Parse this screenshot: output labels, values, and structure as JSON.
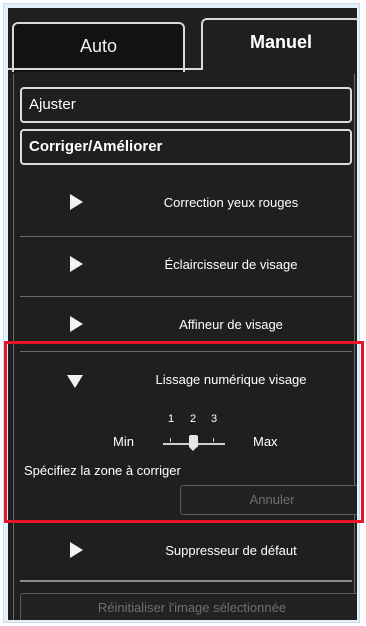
{
  "tabs": {
    "auto_label": "Auto",
    "manual_label": "Manuel"
  },
  "buttons": {
    "adjust_label": "Ajuster",
    "correct_label": "Corriger/Améliorer"
  },
  "sections": [
    {
      "label": "Correction yeux rouges",
      "expanded": false
    },
    {
      "label": "Éclaircisseur de visage",
      "expanded": false
    },
    {
      "label": "Affineur de visage",
      "expanded": false
    },
    {
      "label": "Lissage numérique visage",
      "expanded": true
    },
    {
      "label": "Suppresseur de défaut",
      "expanded": false
    }
  ],
  "smoothing": {
    "min_label": "Min",
    "max_label": "Max",
    "ticks": [
      "1",
      "2",
      "3"
    ],
    "level": 2,
    "instruction": "Spécifiez la zone à corriger",
    "cancel_label": "Annuler"
  },
  "footer": {
    "reset_label": "Réinitialiser l'image sélectionnée"
  },
  "colors": {
    "panel_bg": "#1f1f1f",
    "highlight_border": "#e8142a",
    "frame_bg": "#e3f0fa"
  }
}
